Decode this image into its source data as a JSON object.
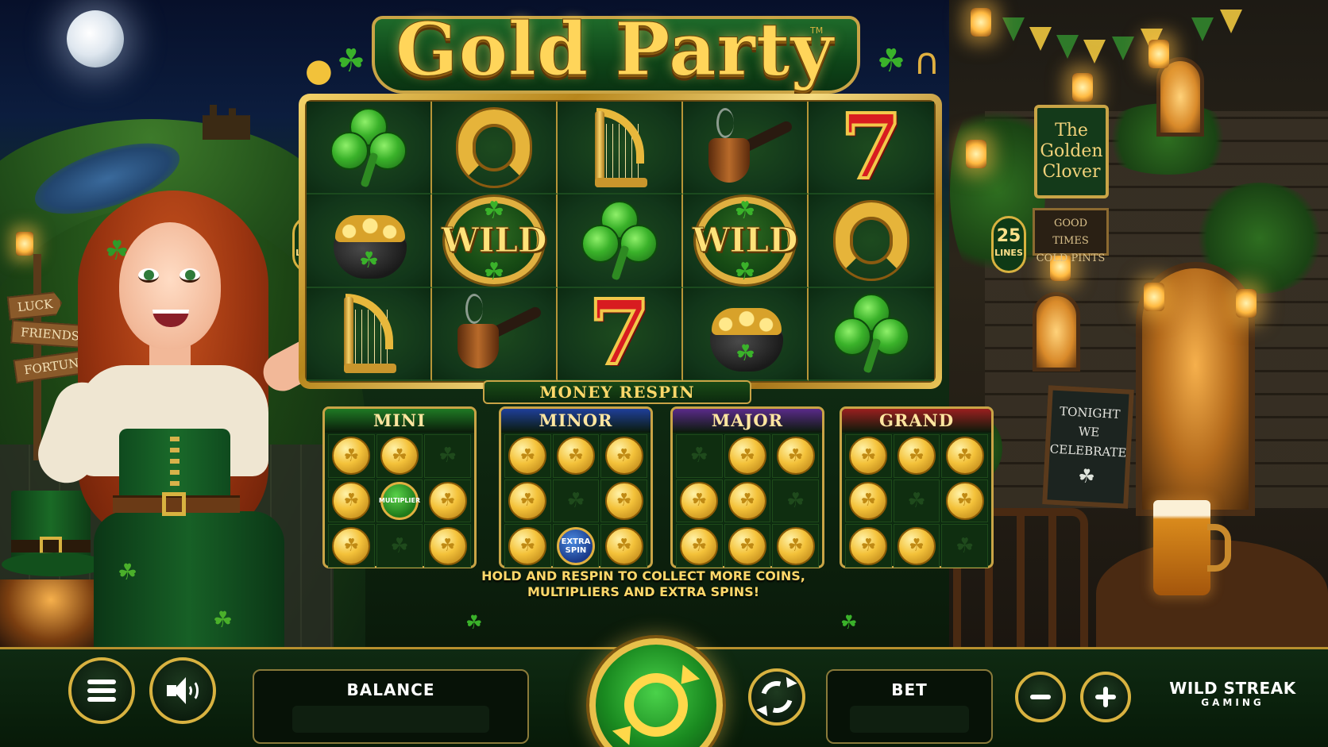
{
  "game": {
    "title": "Gold Party",
    "trademark": "TM"
  },
  "paylines": {
    "count": "25",
    "unit": "LINES"
  },
  "reels": {
    "rows": [
      [
        "clover",
        "horseshoe",
        "harp",
        "pipe",
        "seven"
      ],
      [
        "pot-of-gold",
        "wild",
        "clover",
        "wild",
        "horseshoe"
      ],
      [
        "harp",
        "pipe",
        "seven",
        "pot-of-gold",
        "clover"
      ]
    ],
    "wild_label": "WILD",
    "seven_label": "7"
  },
  "scene": {
    "pub_sign": [
      "The",
      "Golden",
      "Clover"
    ],
    "pub_sign_small": [
      "GOOD TIMES",
      "COLD PINTS"
    ],
    "chalkboard": [
      "TONIGHT",
      "WE",
      "CELEBRATE"
    ],
    "signpost": [
      "LUCK",
      "FRIENDS",
      "FORTUNE"
    ]
  },
  "money_respin": {
    "label": "MONEY RESPIN",
    "jackpots": [
      {
        "name": "MINI",
        "color": "#1f7a24",
        "grid": [
          [
            "coin",
            "coin",
            "empty"
          ],
          [
            "coin",
            "multiplier",
            "coin"
          ],
          [
            "coin",
            "empty",
            "coin"
          ]
        ]
      },
      {
        "name": "MINOR",
        "color": "#1f3f9a",
        "grid": [
          [
            "coin",
            "coin",
            "coin"
          ],
          [
            "coin",
            "empty",
            "coin"
          ],
          [
            "coin",
            "extra",
            "coin"
          ]
        ]
      },
      {
        "name": "MAJOR",
        "color": "#5a2a8a",
        "grid": [
          [
            "empty",
            "coin",
            "coin"
          ],
          [
            "coin",
            "coin",
            "empty"
          ],
          [
            "coin",
            "coin",
            "coin"
          ]
        ]
      },
      {
        "name": "GRAND",
        "color": "#9a1f1f",
        "grid": [
          [
            "coin",
            "coin",
            "coin"
          ],
          [
            "coin",
            "empty",
            "coin"
          ],
          [
            "coin",
            "coin",
            "empty"
          ]
        ]
      }
    ],
    "multiplier_label": "MULTIPLIER",
    "extra_spin_label": "EXTRA SPIN",
    "hold_text_1": "HOLD AND RESPIN TO COLLECT MORE COINS,",
    "hold_text_2": "MULTIPLIERS AND EXTRA SPINS!"
  },
  "controls": {
    "menu_icon": "hamburger-menu-icon",
    "sound_icon": "speaker-icon",
    "balance_label": "BALANCE",
    "balance_value": "",
    "spin_icon": "spin-arrows-icon",
    "autoplay_icon": "autoplay-icon",
    "bet_label": "BET",
    "bet_value": "",
    "minus_icon": "minus-icon",
    "plus_icon": "plus-icon"
  },
  "brand": {
    "line1": "WILD STREAK",
    "line2": "GAMING"
  },
  "colors": {
    "gold": "#d8b240",
    "felt_green": "#0e2e12",
    "spin_green": "#1a8a20"
  }
}
